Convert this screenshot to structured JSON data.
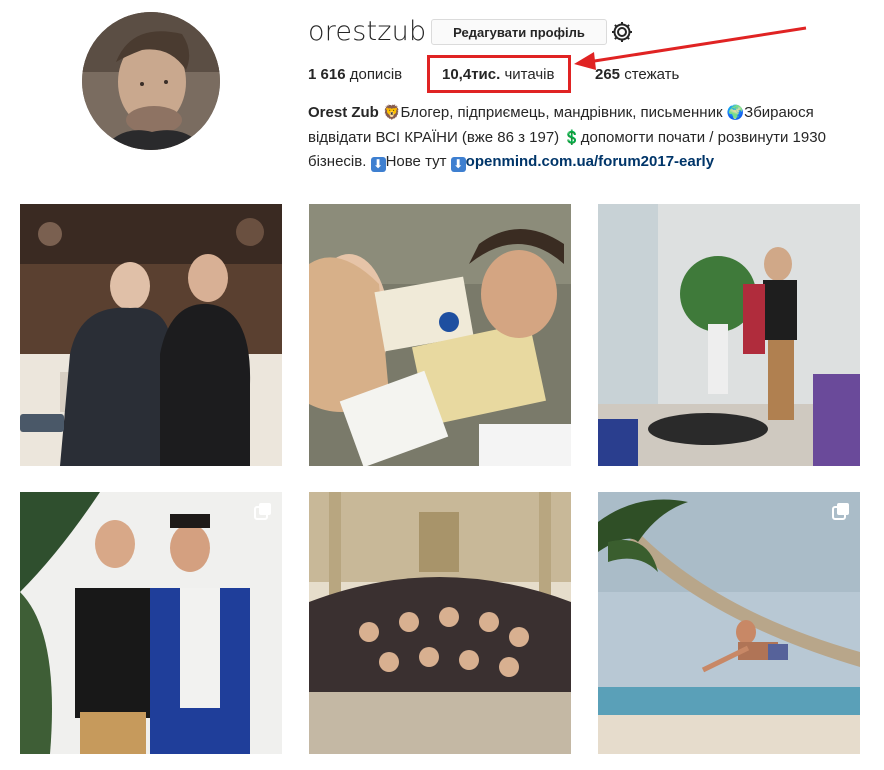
{
  "profile": {
    "username": "orestzub",
    "edit_label": "Редагувати профіль",
    "stats": {
      "posts_value": "1 616",
      "posts_label": "дописів",
      "followers_value": "10,4тис.",
      "followers_label": "читачів",
      "following_value": "265",
      "following_label": "стежать"
    },
    "bio": {
      "name": "Orest Zub",
      "emoji_lion": "🦁",
      "part1": "Блогер, підприємець, мандрівник, письменник",
      "emoji_globe": "🌍",
      "part2": "Збираюся відвідати ВСІ КРАЇНИ (вже 86 з 197)",
      "emoji_dollar": "💲",
      "part3": "допомогти почати / розвинути 1930 бізнесів.",
      "emoji_down1": "⬇",
      "part4": "Нове тут",
      "emoji_down2": "⬇",
      "link": "openmind.com.ua/forum2017-early"
    }
  },
  "annotation": {
    "color": "#e02323"
  },
  "posts": [
    {
      "name": "restaurant-photo",
      "multi": false
    },
    {
      "name": "selfie-photo",
      "multi": false
    },
    {
      "name": "yoga-photo",
      "multi": false
    },
    {
      "name": "two-men-photo",
      "multi": true
    },
    {
      "name": "crowd-photo",
      "multi": false
    },
    {
      "name": "palm-beach-photo",
      "multi": true
    }
  ]
}
